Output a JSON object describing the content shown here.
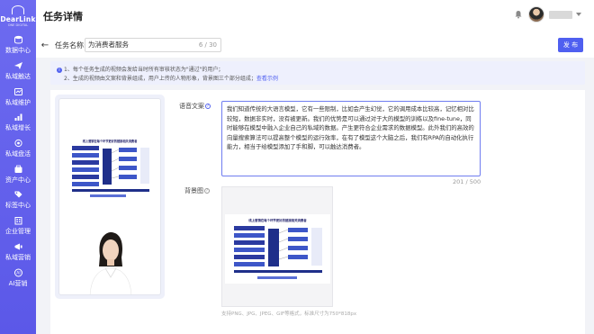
{
  "brand": {
    "name": "DearLink",
    "tagline": "ONE DIGITAL",
    "accent": "#5b58e8"
  },
  "sidebar": {
    "items": [
      {
        "label": "数据中心",
        "icon": "data-center-icon"
      },
      {
        "label": "私域触达",
        "icon": "send-icon"
      },
      {
        "label": "私域维护",
        "icon": "maintain-icon"
      },
      {
        "label": "私域增长",
        "icon": "growth-icon"
      },
      {
        "label": "私域盘活",
        "icon": "activate-icon"
      },
      {
        "label": "资产中心",
        "icon": "asset-icon"
      },
      {
        "label": "标签中心",
        "icon": "tag-icon"
      },
      {
        "label": "企业管理",
        "icon": "enterprise-icon"
      },
      {
        "label": "私域营销",
        "icon": "marketing-icon"
      },
      {
        "label": "AI营销",
        "icon": "ai-icon"
      }
    ]
  },
  "header": {
    "title": "任务详情"
  },
  "task": {
    "name_label": "任务名称:",
    "name_value": "为消费者服务",
    "name_count": "6 / 30",
    "publish_label": "发 布"
  },
  "notice": {
    "line1": "1、每个任务生成的视频会发给当时所有审核状态为\"通过\"的用户；",
    "line2": "2、生成的视频由文案和背景组成，用户上传的人物形象，背景图三个部分组成；",
    "link": "查看示例"
  },
  "form": {
    "script_label": "语音文案",
    "script_text": "我们知道传统的大语言模型，它有一些限制，比如会产生幻觉，它的调用成本比较高，记忆相对比较短，数据非实时，没有被更新。我们的优势是可以通过对于大的模型的训练以及fine-tune，同时能够在模型中融入企业自己的私域的数据。产生更符合企业需求的数据模型。此外我们的高效的向量搜索算法可以提高整个模型的运行效率，在有了模型这个大脑之后，我们有RPA的自动化执行能力，相当于给模型添加了手和脚，可以触达消费者。",
    "script_count": "201 / 500",
    "bg_label": "背景图",
    "bg_hint": "支持PNG、JPG、JPEG、GIF等格式，标准尺寸为750*818px"
  },
  "preview": {
    "doc_title": "线上营销在每个环节更好的链接相关消费者"
  }
}
